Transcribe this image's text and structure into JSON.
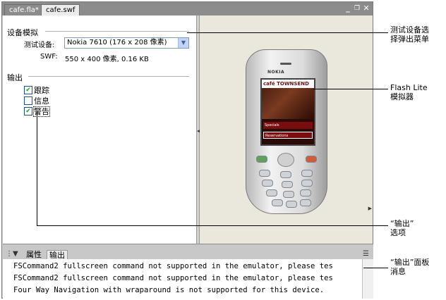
{
  "tabs": [
    {
      "label": "cafe.fla*"
    },
    {
      "label": "cafe.swf"
    }
  ],
  "window_controls": {
    "minimize": "_",
    "restore": "❐",
    "close": "✕"
  },
  "device_settings": {
    "section_title": "设备模拟",
    "test_device_label": "测试设备:",
    "test_device_value": "Nokia 7610 (176 x 208 像素)",
    "swf_label": "SWF:",
    "swf_value": "550 x 400 像素, 0.16 KB"
  },
  "output_settings": {
    "section_title": "输出",
    "checkboxes": [
      {
        "label": "跟踪",
        "checked": true
      },
      {
        "label": "信息",
        "checked": false
      },
      {
        "label": "警告",
        "checked": true
      }
    ]
  },
  "phone": {
    "brand": "NOKIA",
    "screen_title": "café TOWNSEND",
    "menu_items": [
      "Specials",
      "Reservations"
    ]
  },
  "output_panel": {
    "tabs": [
      "属性",
      "输出"
    ],
    "lines": [
      "FSCommand2 fullscreen command not supported in the emulator, please tes",
      "FSCommand2 fullscreen command not supported in the emulator, please tes",
      "Four Way Navigation with wraparound is not supported for this device."
    ]
  },
  "annotations": [
    {
      "text_line1": "测试设备选",
      "text_line2": "择弹出菜单"
    },
    {
      "text_line1": "Flash Lite",
      "text_line2": "模拟器"
    },
    {
      "text_line1": "“输出”",
      "text_line2": "选项"
    },
    {
      "text_line1": "“输出”面板",
      "text_line2": "消息"
    }
  ],
  "colors": {
    "check_mark": "#21a121",
    "tab_bar": "#8c8c8c",
    "stage_bg": "#eae8dd"
  }
}
